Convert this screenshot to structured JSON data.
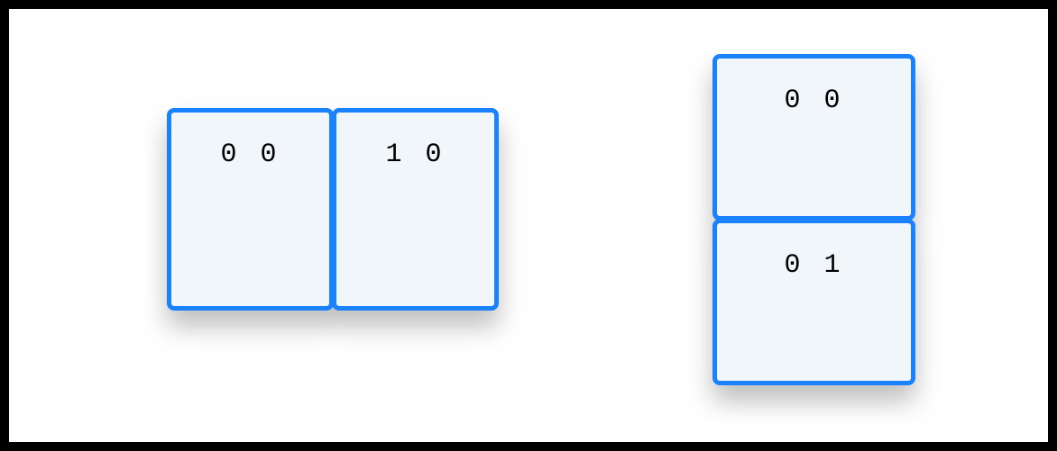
{
  "groups": {
    "left": {
      "cells": [
        "0 0",
        "1 0"
      ]
    },
    "right": {
      "cells": [
        "0 0",
        "0 1"
      ]
    }
  }
}
